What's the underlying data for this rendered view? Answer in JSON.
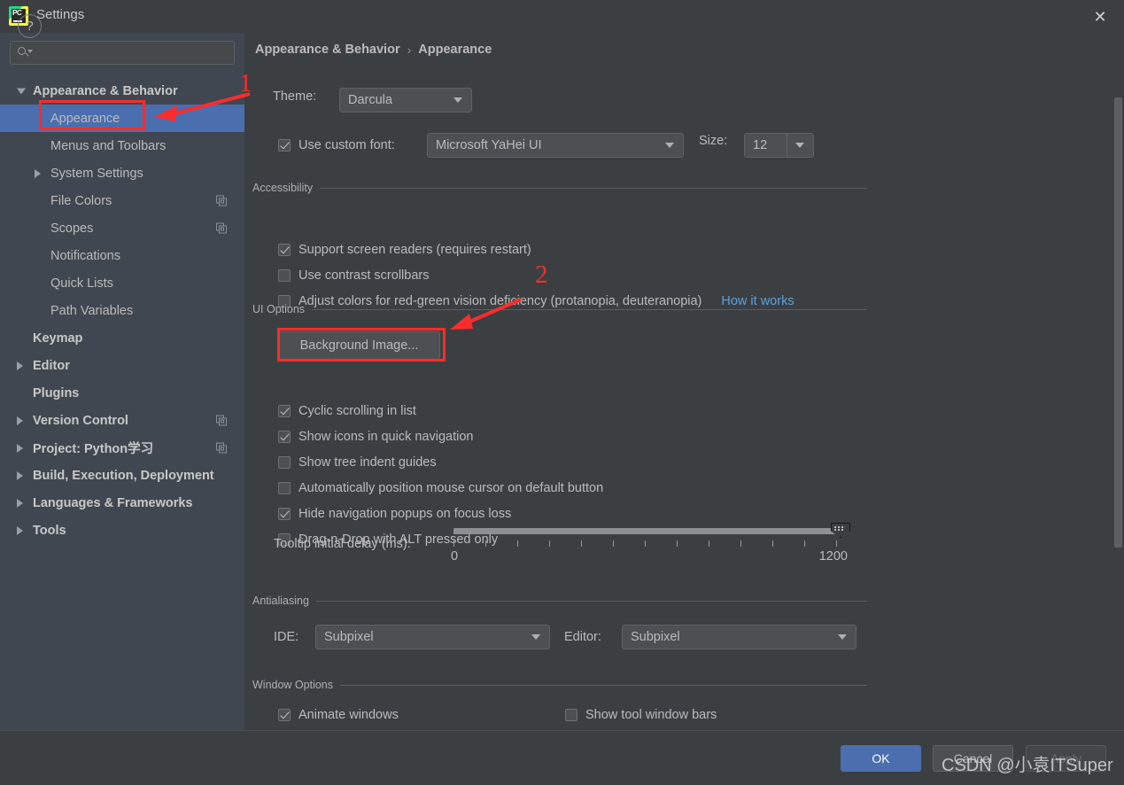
{
  "window": {
    "title": "Settings",
    "app_icon": "pycharm-icon",
    "close_icon": "close-icon"
  },
  "search": {
    "placeholder": "",
    "value": "",
    "icon": "search-icon"
  },
  "sidebar": {
    "items": [
      {
        "label": "Appearance & Behavior",
        "level": 0,
        "twisty": "expanded",
        "bold": true,
        "selected": false,
        "copy_icon": false
      },
      {
        "label": "Appearance",
        "level": 1,
        "twisty": "none",
        "bold": false,
        "selected": true,
        "copy_icon": false
      },
      {
        "label": "Menus and Toolbars",
        "level": 1,
        "twisty": "none",
        "bold": false,
        "selected": false,
        "copy_icon": false
      },
      {
        "label": "System Settings",
        "level": 1,
        "twisty": "collapsed",
        "bold": false,
        "selected": false,
        "copy_icon": false
      },
      {
        "label": "File Colors",
        "level": 1,
        "twisty": "none",
        "bold": false,
        "selected": false,
        "copy_icon": true
      },
      {
        "label": "Scopes",
        "level": 1,
        "twisty": "none",
        "bold": false,
        "selected": false,
        "copy_icon": true
      },
      {
        "label": "Notifications",
        "level": 1,
        "twisty": "none",
        "bold": false,
        "selected": false,
        "copy_icon": false
      },
      {
        "label": "Quick Lists",
        "level": 1,
        "twisty": "none",
        "bold": false,
        "selected": false,
        "copy_icon": false
      },
      {
        "label": "Path Variables",
        "level": 1,
        "twisty": "none",
        "bold": false,
        "selected": false,
        "copy_icon": false
      },
      {
        "label": "Keymap",
        "level": 0,
        "twisty": "none",
        "bold": true,
        "selected": false,
        "copy_icon": false
      },
      {
        "label": "Editor",
        "level": 0,
        "twisty": "collapsed",
        "bold": true,
        "selected": false,
        "copy_icon": false
      },
      {
        "label": "Plugins",
        "level": 0,
        "twisty": "none",
        "bold": true,
        "selected": false,
        "copy_icon": false
      },
      {
        "label": "Version Control",
        "level": 0,
        "twisty": "collapsed",
        "bold": true,
        "selected": false,
        "copy_icon": true
      },
      {
        "label": "Project: Python学习",
        "level": 0,
        "twisty": "collapsed",
        "bold": true,
        "selected": false,
        "copy_icon": true
      },
      {
        "label": "Build, Execution, Deployment",
        "level": 0,
        "twisty": "collapsed",
        "bold": true,
        "selected": false,
        "copy_icon": false
      },
      {
        "label": "Languages & Frameworks",
        "level": 0,
        "twisty": "collapsed",
        "bold": true,
        "selected": false,
        "copy_icon": false
      },
      {
        "label": "Tools",
        "level": 0,
        "twisty": "collapsed",
        "bold": true,
        "selected": false,
        "copy_icon": false
      }
    ]
  },
  "breadcrumb": {
    "parent": "Appearance & Behavior",
    "separator": "›",
    "current": "Appearance"
  },
  "appearance": {
    "theme_label": "Theme:",
    "theme_value": "Darcula",
    "custom_font_label": "Use custom font:",
    "custom_font_checked": true,
    "custom_font_value": "Microsoft YaHei UI",
    "size_label": "Size:",
    "size_value": "12"
  },
  "accessibility": {
    "title": "Accessibility",
    "options": [
      {
        "label": "Support screen readers (requires restart)",
        "checked": true
      },
      {
        "label": "Use contrast scrollbars",
        "checked": false
      },
      {
        "label": "Adjust colors for red-green vision deficiency (protanopia, deuteranopia)",
        "checked": false
      }
    ],
    "how_it_works_link": "How it works"
  },
  "ui_options": {
    "title": "UI Options",
    "background_image_button": "Background Image...",
    "options": [
      {
        "label": "Cyclic scrolling in list",
        "checked": true
      },
      {
        "label": "Show icons in quick navigation",
        "checked": true
      },
      {
        "label": "Show tree indent guides",
        "checked": false
      },
      {
        "label": "Automatically position mouse cursor on default button",
        "checked": false
      },
      {
        "label": "Hide navigation popups on focus loss",
        "checked": true
      },
      {
        "label": "Drag-n-Drop with ALT pressed only",
        "checked": false
      }
    ],
    "tooltip_delay_label": "Tooltip initial delay (ms):",
    "tooltip_delay_min": "0",
    "tooltip_delay_max": "1200",
    "tooltip_delay_value": "1200"
  },
  "antialiasing": {
    "title": "Antialiasing",
    "ide_label": "IDE:",
    "ide_value": "Subpixel",
    "editor_label": "Editor:",
    "editor_value": "Subpixel"
  },
  "window_options": {
    "title": "Window Options",
    "options": [
      {
        "label": "Animate windows",
        "checked": true
      },
      {
        "label": "Show tool window bars",
        "checked": false
      }
    ]
  },
  "footer": {
    "help_label": "?",
    "ok_label": "OK",
    "cancel_label": "Cancel",
    "apply_label": "Apply"
  },
  "annotations": {
    "marker_one": "1",
    "marker_two": "2"
  },
  "watermark": "CSDN @小袁ITSuper",
  "colors": {
    "background": "#3c3f41",
    "sidebar": "#414750",
    "selection": "#4b6eaf",
    "accent_link": "#5ba2e0",
    "annotation_red": "#fb2c2c",
    "text": "#bbbbbb"
  }
}
